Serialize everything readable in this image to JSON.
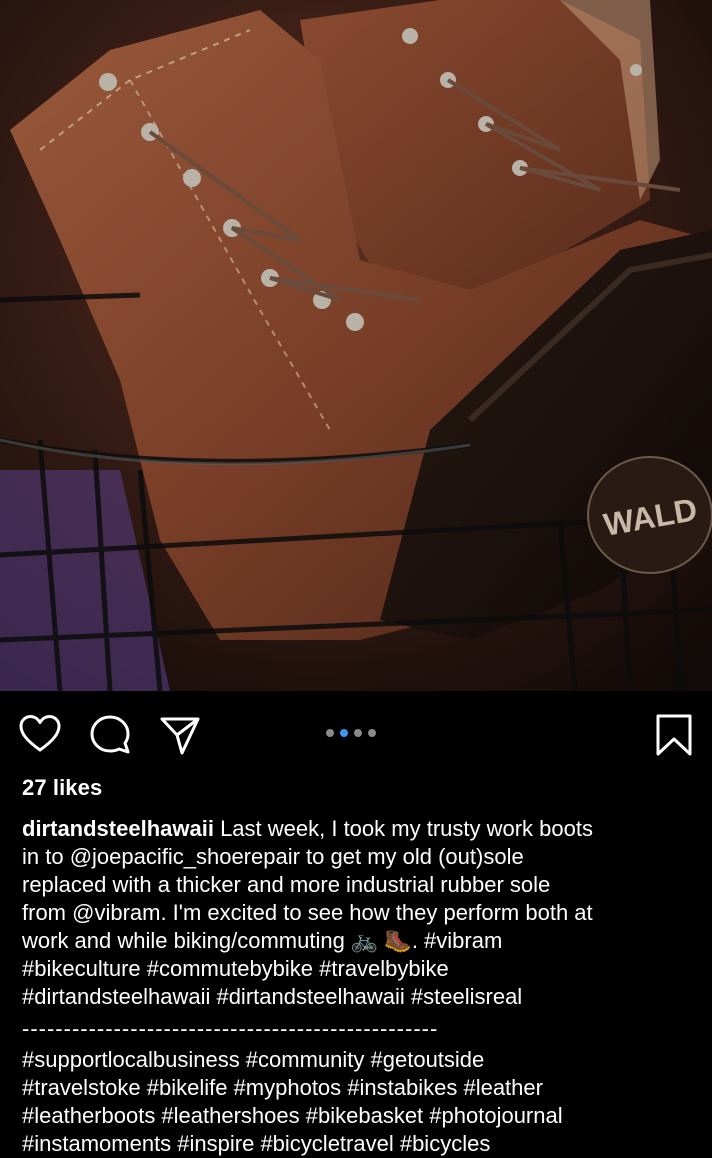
{
  "post": {
    "likes": "27 likes",
    "username": "dirtandsteelhawaii",
    "caption": " Last week, I took my trusty work boots\nin to @joepacific_shoerepair to get my old (out)sole\nreplaced with a thicker and more industrial rubber sole\nfrom @vibram. I'm excited to see how they perform both at\nwork and while biking/commuting 🚲 🥾. #vibram\n#bikeculture #commutebybike #travelbybike\n#dirtandsteelhawaii #dirtandsteelhawaii #steelisreal",
    "separator": "--------------------------------------------------",
    "hashtags_more": "#supportlocalbusiness #community #getoutside\n#travelstoke #bikelife #myphotos #instabikes #leather\n#leatherboots #leathershoes #bikebasket #photojournal\n#instamoments #inspire #bicycletravel #bicycles",
    "photo_badge_text": "WALD"
  },
  "carousel": {
    "count": 4,
    "active_index": 1
  },
  "icons": {
    "like": "heart-icon",
    "comment": "comment-bubble-icon",
    "share": "paper-plane-icon",
    "save": "bookmark-icon"
  },
  "colors": {
    "background": "#000000",
    "text": "#ffffff",
    "active_dot": "#3897f0",
    "inactive_dot": "#8a8a8a"
  }
}
